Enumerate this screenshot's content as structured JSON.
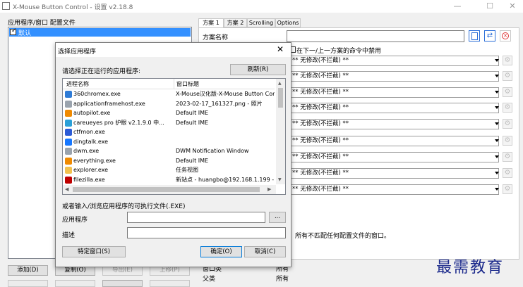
{
  "window": {
    "title": "X-Mouse Button Control - 设置 v2.18.8"
  },
  "left": {
    "group_label": "应用程序/窗口 配置文件",
    "items": [
      {
        "label": "默认",
        "checked": true,
        "selected": true
      }
    ],
    "buttons": [
      {
        "label": "添加(D)",
        "enabled": true
      },
      {
        "label": "复制(O)",
        "enabled": true
      },
      {
        "label": "导出(E)",
        "enabled": false
      },
      {
        "label": "上移(P)",
        "enabled": false
      }
    ]
  },
  "tabs": [
    {
      "label": "方案 1",
      "active": true
    },
    {
      "label": "方案 2",
      "active": false
    },
    {
      "label": "Scrolling",
      "active": false
    },
    {
      "label": "Options",
      "active": false
    }
  ],
  "profile": {
    "name_label": "方案名称",
    "disable_checkbox_label": "在下一/上一方案的命令中禁用",
    "combo_value": "** 无修改(不拦截) **",
    "match_info": "所有不匹配任何配置文件的窗口。",
    "bottom_rows": [
      {
        "label": "窗口类",
        "value": "所有"
      },
      {
        "label": "父类",
        "value": "所有"
      }
    ]
  },
  "dialog": {
    "title": "选择应用程序",
    "prompt": "请选择正在运行的应用程序:",
    "refresh_button": "刷新(R)",
    "columns": [
      "进程名称",
      "窗口标题"
    ],
    "processes": [
      {
        "name": "360chromex.exe",
        "title": "X-Mouse汉化版-X-Mouse Button Con",
        "icon": "chrome-icon",
        "color": "#2e7bd6"
      },
      {
        "name": "applicationframehost.exe",
        "title": "2023-02-17_161327.png - 照片",
        "icon": "frame-icon",
        "color": "#9aa3ad"
      },
      {
        "name": "autopilot.exe",
        "title": "Default IME",
        "icon": "autopilot-icon",
        "color": "#f08a00"
      },
      {
        "name": "careueyes pro 护眼 v2.1.9.0 中...",
        "title": "Default IME",
        "icon": "eye-icon",
        "color": "#2aa0d8"
      },
      {
        "name": "ctfmon.exe",
        "title": "",
        "icon": "pen-icon",
        "color": "#2b5bd6"
      },
      {
        "name": "dingtalk.exe",
        "title": "",
        "icon": "dingtalk-icon",
        "color": "#1677ff"
      },
      {
        "name": "dwm.exe",
        "title": "DWM Notification Window",
        "icon": "window-icon",
        "color": "#9aa3ad"
      },
      {
        "name": "everything.exe",
        "title": "Default IME",
        "icon": "search-icon",
        "color": "#f08a00"
      },
      {
        "name": "explorer.exe",
        "title": "任务视图",
        "icon": "folder-icon",
        "color": "#f2c14e"
      },
      {
        "name": "filezilla.exe",
        "title": "新站点 - huangbo@192.168.1.199 -",
        "icon": "filezilla-icon",
        "color": "#bf0000"
      }
    ],
    "browse_label": "或者输入/浏览应用程序的可执行文件(.EXE)",
    "app_label": "应用程序",
    "browse_button": "...",
    "desc_label": "描述",
    "specific_window_button": "特定窗口(S)",
    "ok_button": "确定(O)",
    "cancel_button": "取消(C)"
  },
  "watermark": "最需教育"
}
